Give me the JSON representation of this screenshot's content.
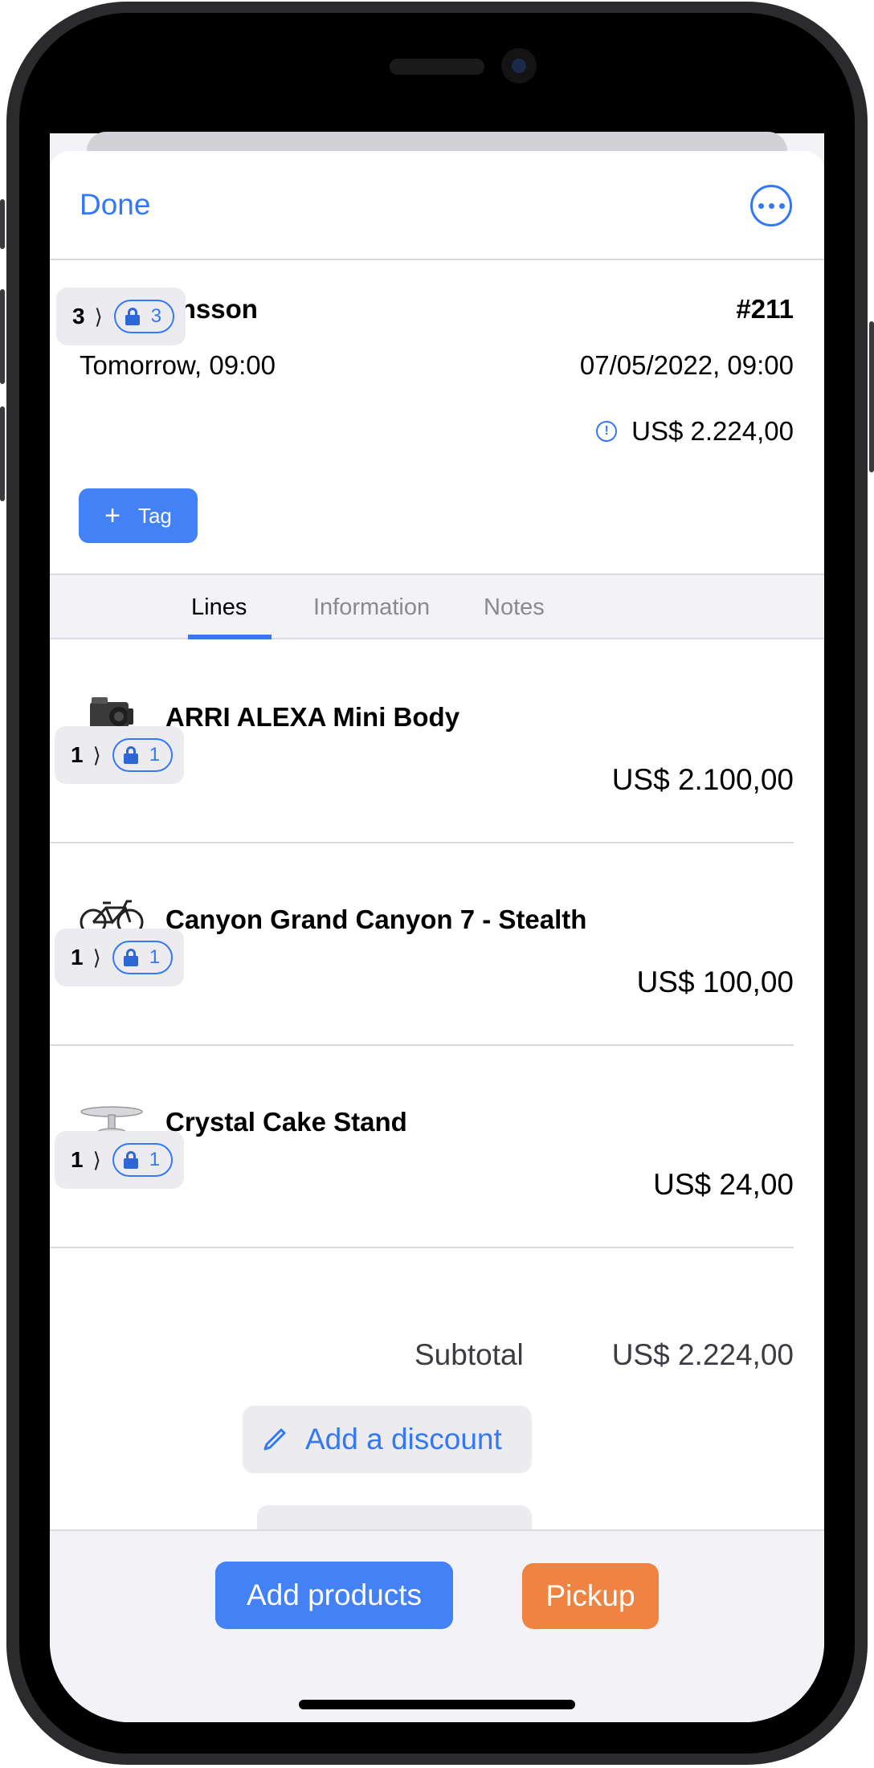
{
  "nav": {
    "done_label": "Done",
    "more_icon": "ellipsis-circle-icon"
  },
  "order": {
    "customer": "Joe Johnsson",
    "number": "#211",
    "relative_time": "Tomorrow, 09:00",
    "datetime": "07/05/2022, 09:00",
    "qty": "3",
    "reserved": "3",
    "total": "US$ 2.224,00",
    "tag_label": "Tag"
  },
  "tabs": [
    {
      "label": "Lines",
      "active": true
    },
    {
      "label": "Information",
      "active": false
    },
    {
      "label": "Notes",
      "active": false
    }
  ],
  "lines": [
    {
      "name": "ARRI ALEXA Mini Body",
      "qty": "1",
      "reserved": "1",
      "price": "US$ 2.100,00",
      "icon": "camera-thumbnail"
    },
    {
      "name": "Canyon Grand Canyon 7 - Stealth",
      "qty": "1",
      "reserved": "1",
      "price": "US$ 100,00",
      "icon": "bicycle-thumbnail"
    },
    {
      "name": "Crystal Cake Stand",
      "qty": "1",
      "reserved": "1",
      "price": "US$ 24,00",
      "icon": "cake-stand-thumbnail"
    }
  ],
  "summary": {
    "subtotal_label": "Subtotal",
    "subtotal_value": "US$ 2.224,00",
    "discount_label": "Add a discount"
  },
  "actions": {
    "add_products_label": "Add products",
    "pickup_label": "Pickup"
  },
  "colors": {
    "accent": "#3478f6",
    "primary_button": "#4381f7",
    "pickup_button": "#ef8341"
  }
}
